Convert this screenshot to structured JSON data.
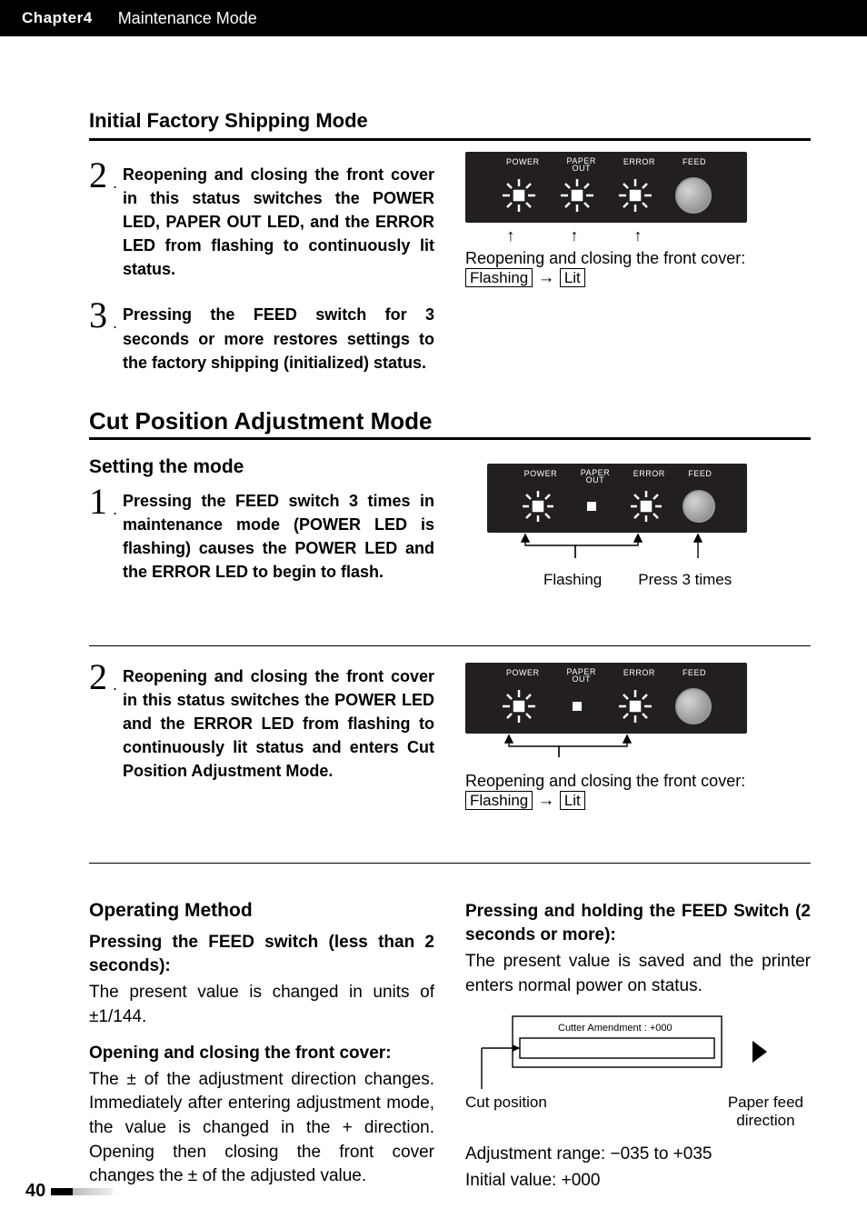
{
  "header": {
    "chapter": "Chapter4",
    "title": "Maintenance Mode"
  },
  "initial_factory": {
    "heading": "Initial Factory Shipping Mode",
    "step2_num": "2",
    "step2": "Reopening and closing the front cover in this status switches the POWER LED, PAPER OUT LED, and the ERROR LED from flashing to continuously lit status.",
    "step3_num": "3",
    "step3": "Pressing the FEED switch for 3 seconds or more restores settings to the factory shipping (initialized) status.",
    "panel_caption": "Reopening and closing the front cover:",
    "state_from": "Flashing",
    "arrow": "→",
    "state_to": "Lit"
  },
  "cut_position": {
    "heading": "Cut Position Adjustment Mode",
    "setting_heading": "Setting the mode",
    "step1_num": "1",
    "step1": "Pressing the FEED switch 3 times in maintenance mode (POWER LED is flashing) causes the POWER LED and the ERROR LED to begin to flash.",
    "panel1_flashing": "Flashing",
    "panel1_press": "Press 3 times",
    "step2_num": "2",
    "step2": "Reopening and closing the front cover in this status switches the POWER LED and the ERROR LED from flashing to continuously lit status and enters Cut Position Adjustment Mode.",
    "panel2_caption": "Reopening and closing the front cover:",
    "state_from": "Flashing",
    "arrow": "→",
    "state_to": "Lit"
  },
  "operating": {
    "heading": "Operating Method",
    "feed_short_h": "Pressing the FEED switch (less than 2 seconds):",
    "feed_short_body": "The present value is changed in units of ±1/144.",
    "open_close_h": "Opening and closing the front cover:",
    "open_close_body": "The ± of the adjustment direction changes. Immediately after entering adjustment mode, the value is changed in the + direction. Opening then closing the front cover changes the ± of the adjusted value.",
    "feed_long_h": "Pressing and holding the FEED Switch (2 seconds or more):",
    "feed_long_body": "The present value is saved and the printer enters normal power on status.",
    "diagram_label": "Cutter Amendment : +000",
    "cut_position_label": "Cut position",
    "paper_feed_label_l1": "Paper feed",
    "paper_feed_label_l2": "direction",
    "range": "Adjustment range: −035 to +035",
    "initial": "Initial value: +000"
  },
  "panel_labels": {
    "power": "POWER",
    "paper_top": "PAPER",
    "paper_bot": "OUT",
    "error": "ERROR",
    "feed": "FEED"
  },
  "page_number": "40"
}
